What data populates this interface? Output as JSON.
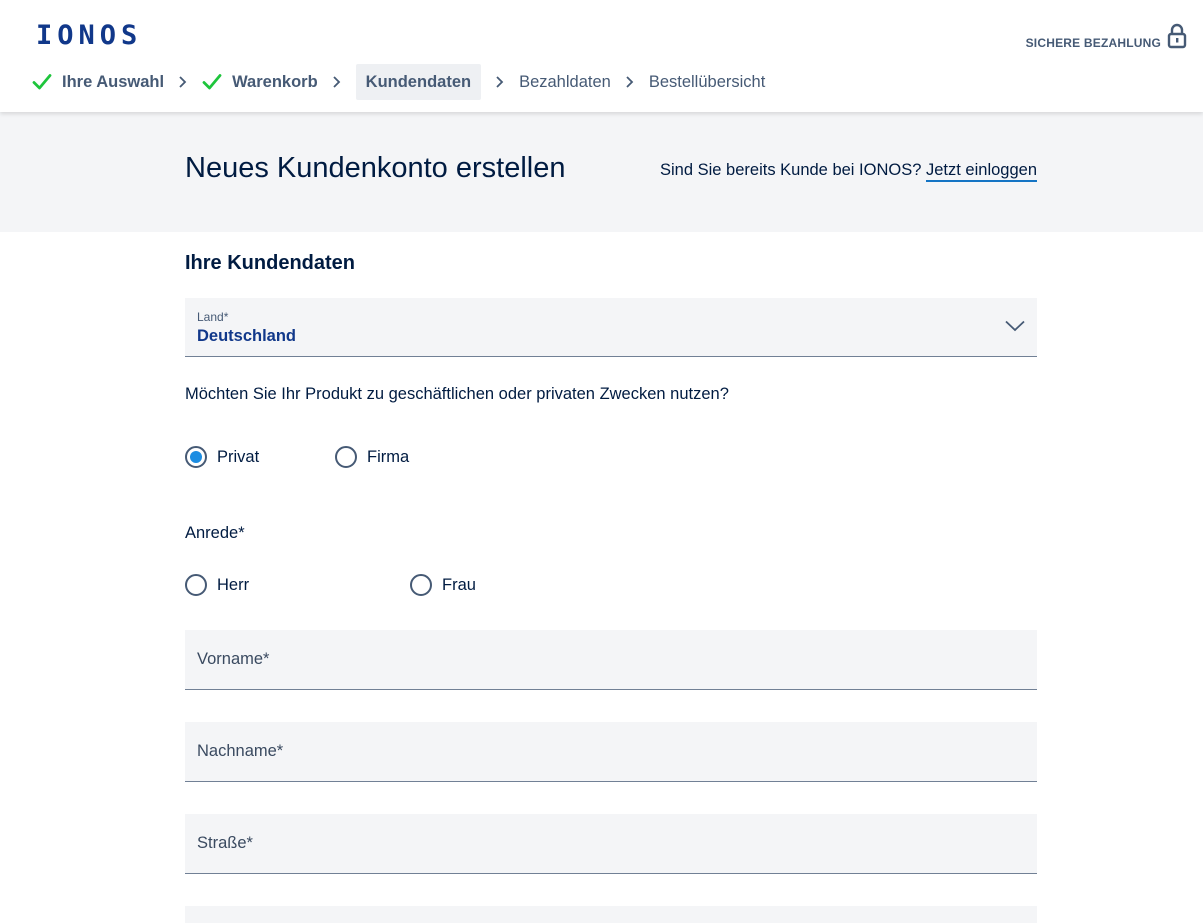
{
  "header": {
    "logo": "IONOS",
    "secure_payment": "SICHERE BEZAHLUNG"
  },
  "steps": [
    {
      "label": "Ihre Auswahl",
      "state": "done"
    },
    {
      "label": "Warenkorb",
      "state": "done"
    },
    {
      "label": "Kundendaten",
      "state": "active"
    },
    {
      "label": "Bezahldaten",
      "state": "todo"
    },
    {
      "label": "Bestellübersicht",
      "state": "todo"
    }
  ],
  "hero": {
    "title": "Neues Kundenkonto erstellen",
    "login_question": "Sind Sie bereits Kunde bei IONOS?",
    "login_link": "Jetzt einloggen"
  },
  "form": {
    "section_title": "Ihre Kundendaten",
    "country": {
      "label": "Land*",
      "value": "Deutschland"
    },
    "usage_question": "Möchten Sie Ihr Produkt zu geschäftlichen oder privaten Zwecken nutzen?",
    "usage_options": [
      {
        "label": "Privat",
        "checked": true
      },
      {
        "label": "Firma",
        "checked": false
      }
    ],
    "salutation_label": "Anrede*",
    "salutation_options": [
      {
        "label": "Herr",
        "checked": false
      },
      {
        "label": "Frau",
        "checked": false
      }
    ],
    "fields": [
      {
        "placeholder": "Vorname*"
      },
      {
        "placeholder": "Nachname*"
      },
      {
        "placeholder": "Straße*"
      }
    ]
  },
  "colors": {
    "brand": "#11388a",
    "check": "#1ec53c",
    "radio_selected": "#1c8de2",
    "link_underline": "#1474c4",
    "field_bg": "#f4f5f7"
  }
}
